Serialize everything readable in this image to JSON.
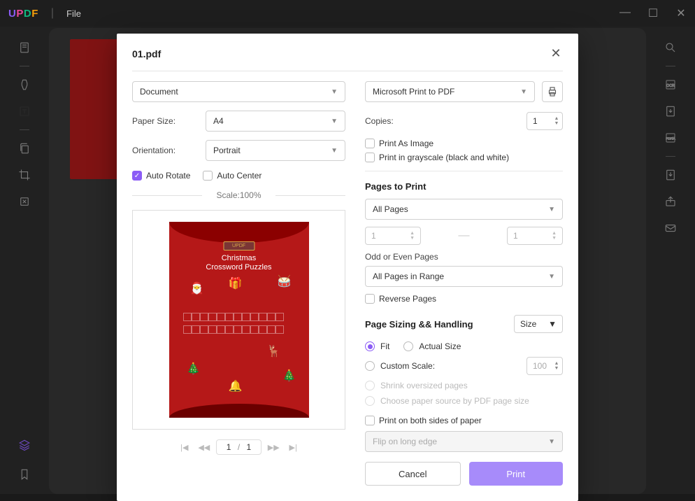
{
  "app": {
    "logo": "UPDF",
    "file_menu": "File",
    "filename": "01.pdf"
  },
  "dialog": {
    "title": "01.pdf",
    "doc_type": "Document",
    "paper_size_label": "Paper Size:",
    "paper_size": "A4",
    "orientation_label": "Orientation:",
    "orientation": "Portrait",
    "auto_rotate": "Auto Rotate",
    "auto_center": "Auto Center",
    "scale_label": "Scale:100%",
    "pager": {
      "current": "1",
      "sep": "/",
      "total": "1"
    },
    "printer": "Microsoft Print to PDF",
    "copies_label": "Copies:",
    "copies": "1",
    "print_as_image": "Print As Image",
    "print_grayscale": "Print in grayscale (black and white)",
    "pages_section": "Pages to Print",
    "pages_all": "All Pages",
    "range_from": "1",
    "range_to": "1",
    "odd_even_label": "Odd or Even Pages",
    "odd_even": "All Pages in Range",
    "reverse": "Reverse Pages",
    "sizing_section": "Page Sizing && Handling",
    "size_mode": "Size",
    "fit": "Fit",
    "actual": "Actual Size",
    "custom_scale": "Custom Scale:",
    "custom_scale_val": "100",
    "shrink": "Shrink oversized pages",
    "choose_paper": "Choose paper source by PDF page size",
    "both_sides": "Print on both sides of paper",
    "flip": "Flip on long edge",
    "cancel": "Cancel",
    "print": "Print"
  },
  "preview": {
    "brand": "UPDF",
    "title1": "Christmas",
    "title2": "Crossword Puzzles"
  }
}
